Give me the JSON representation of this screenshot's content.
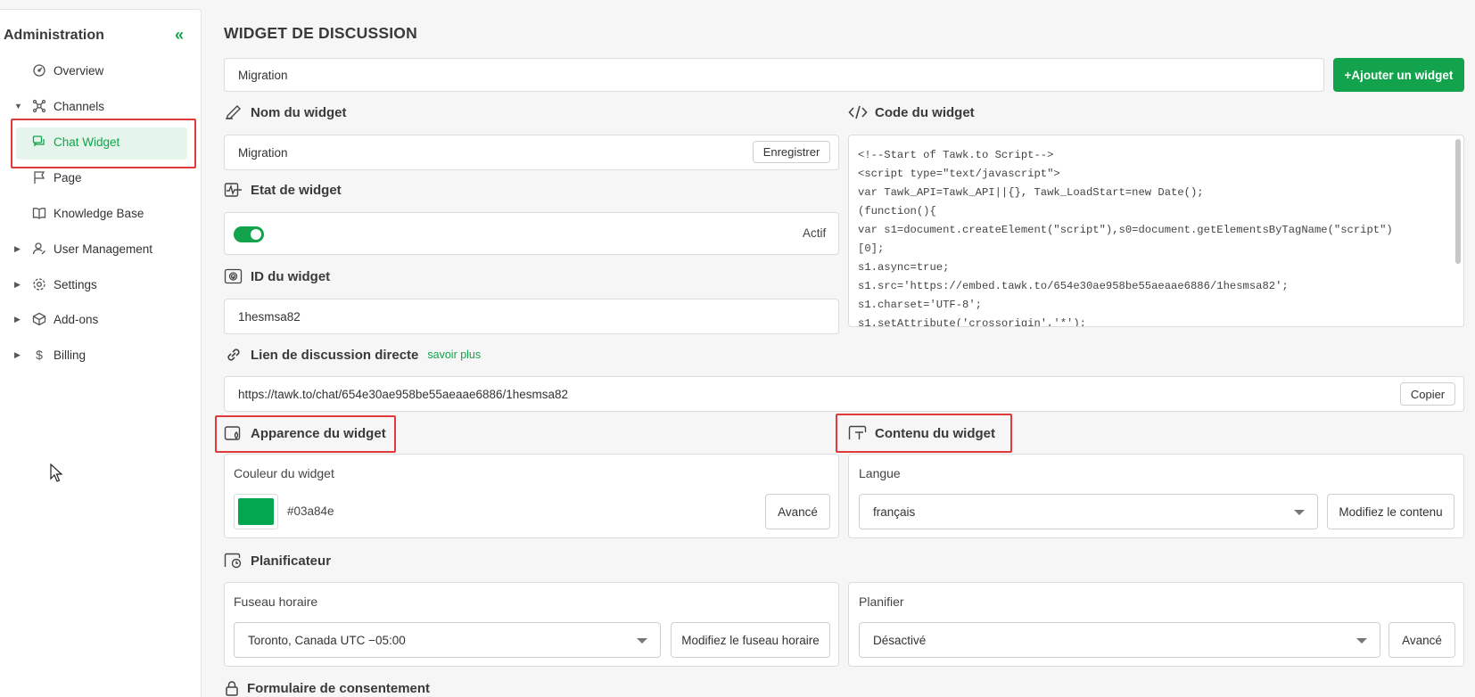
{
  "sidebar": {
    "title": "Administration",
    "collapse_icon": "double-chevron-left-icon",
    "items": [
      {
        "label": "Overview",
        "icon": "overview-icon"
      },
      {
        "label": "Channels",
        "icon": "channels-icon"
      },
      {
        "label": "Chat Widget",
        "icon": "chat-widget-icon"
      },
      {
        "label": "Page",
        "icon": "flag-icon"
      },
      {
        "label": "Knowledge Base",
        "icon": "book-icon"
      },
      {
        "label": "User Management",
        "icon": "user-icon"
      },
      {
        "label": "Settings",
        "icon": "gear-icon"
      },
      {
        "label": "Add-ons",
        "icon": "box-icon"
      },
      {
        "label": "Billing",
        "icon": "dollar-icon"
      }
    ]
  },
  "main": {
    "title": "WIDGET DE DISCUSSION",
    "widget_select_value": "Migration",
    "add_widget_label": "+Ajouter un widget",
    "name_section": {
      "title": "Nom du widget",
      "value": "Migration",
      "save_label": "Enregistrer"
    },
    "state_section": {
      "title": "Etat de widget",
      "status": "Actif",
      "enabled": true
    },
    "id_section": {
      "title": "ID du widget",
      "value": "1hesmsa82"
    },
    "code_section": {
      "title": "Code du widget",
      "lines": [
        "<!--Start of Tawk.to Script-->",
        "<script type=\"text/javascript\">",
        "var Tawk_API=Tawk_API||{}, Tawk_LoadStart=new Date();",
        "(function(){",
        "var s1=document.createElement(\"script\"),s0=document.getElementsByTagName(\"script\")",
        "[0];",
        "s1.async=true;",
        "s1.src='https://embed.tawk.to/654e30ae958be55aeaae6886/1hesmsa82';",
        "s1.charset='UTF-8';",
        "s1.setAttribute('crossorigin','*');"
      ]
    },
    "direct_link_section": {
      "title": "Lien de discussion directe",
      "learn_more": "savoir plus",
      "url": "https://tawk.to/chat/654e30ae958be55aeaae6886/1hesmsa82",
      "copy_label": "Copier"
    },
    "appearance_section": {
      "title": "Apparence du widget",
      "color_label": "Couleur du widget",
      "color_value": "#03a84e",
      "advanced_label": "Avancé"
    },
    "content_section": {
      "title": "Contenu du widget",
      "language_label": "Langue",
      "language_value": "français",
      "modify_label": "Modifiez le contenu"
    },
    "scheduler_section": {
      "title": "Planificateur",
      "timezone_label": "Fuseau horaire",
      "timezone_value": "Toronto, Canada UTC −05:00",
      "modify_timezone_label": "Modifiez le fuseau horaire",
      "schedule_label": "Planifier",
      "schedule_value": "Désactivé",
      "advanced_label": "Avancé"
    },
    "consent_section": {
      "title": "Formulaire de consentement"
    }
  },
  "colors": {
    "accent": "#12a34c",
    "highlight": "#e03b3b",
    "widget_color": "#03a84e"
  }
}
